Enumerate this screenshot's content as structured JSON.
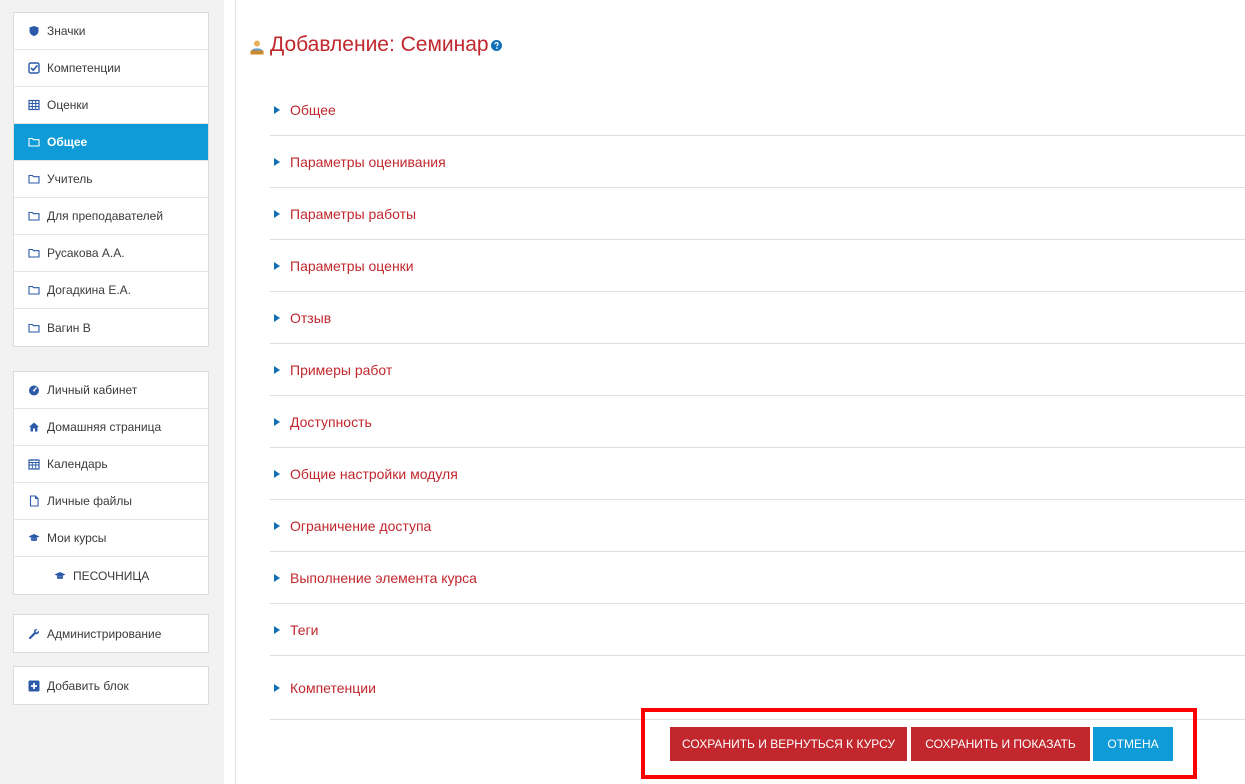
{
  "sidebar": {
    "course_block": [
      {
        "label": "Значки",
        "icon": "shield-icon"
      },
      {
        "label": "Компетенции",
        "icon": "check-square-icon"
      },
      {
        "label": "Оценки",
        "icon": "table-icon"
      },
      {
        "label": "Общее",
        "icon": "folder-icon"
      },
      {
        "label": "Учитель",
        "icon": "folder-icon"
      },
      {
        "label": "Для преподавателей",
        "icon": "folder-icon"
      },
      {
        "label": "Русакова А.А.",
        "icon": "folder-icon"
      },
      {
        "label": "Догадкина Е.А.",
        "icon": "folder-icon"
      },
      {
        "label": "Вагин В",
        "icon": "folder-icon"
      }
    ],
    "nav_block": [
      {
        "label": "Личный кабинет",
        "icon": "dashboard-icon"
      },
      {
        "label": "Домашняя страница",
        "icon": "home-icon"
      },
      {
        "label": "Календарь",
        "icon": "calendar-icon"
      },
      {
        "label": "Личные файлы",
        "icon": "file-icon"
      },
      {
        "label": "Мои курсы",
        "icon": "graduation-cap-icon"
      },
      {
        "label": "ПЕСОЧНИЦА",
        "icon": "graduation-cap-icon"
      }
    ],
    "admin_label": "Администрирование",
    "add_block_label": "Добавить блок"
  },
  "main": {
    "title": "Добавление: Семинар",
    "sections": [
      "Общее",
      "Параметры оценивания",
      "Параметры работы",
      "Параметры оценки",
      "Отзыв",
      "Примеры работ",
      "Доступность",
      "Общие настройки модуля",
      "Ограничение доступа",
      "Выполнение элемента курса",
      "Теги",
      "Компетенции"
    ]
  },
  "buttons": {
    "save_return": "СОХРАНИТЬ И ВЕРНУТЬСЯ К КУРСУ",
    "save_display": "СОХРАНИТЬ И ПОКАЗАТЬ",
    "cancel": "ОТМЕНА"
  },
  "colors": {
    "accent_red": "#c1272d",
    "accent_blue": "#0f9bd7",
    "highlight": "#ff0000"
  }
}
